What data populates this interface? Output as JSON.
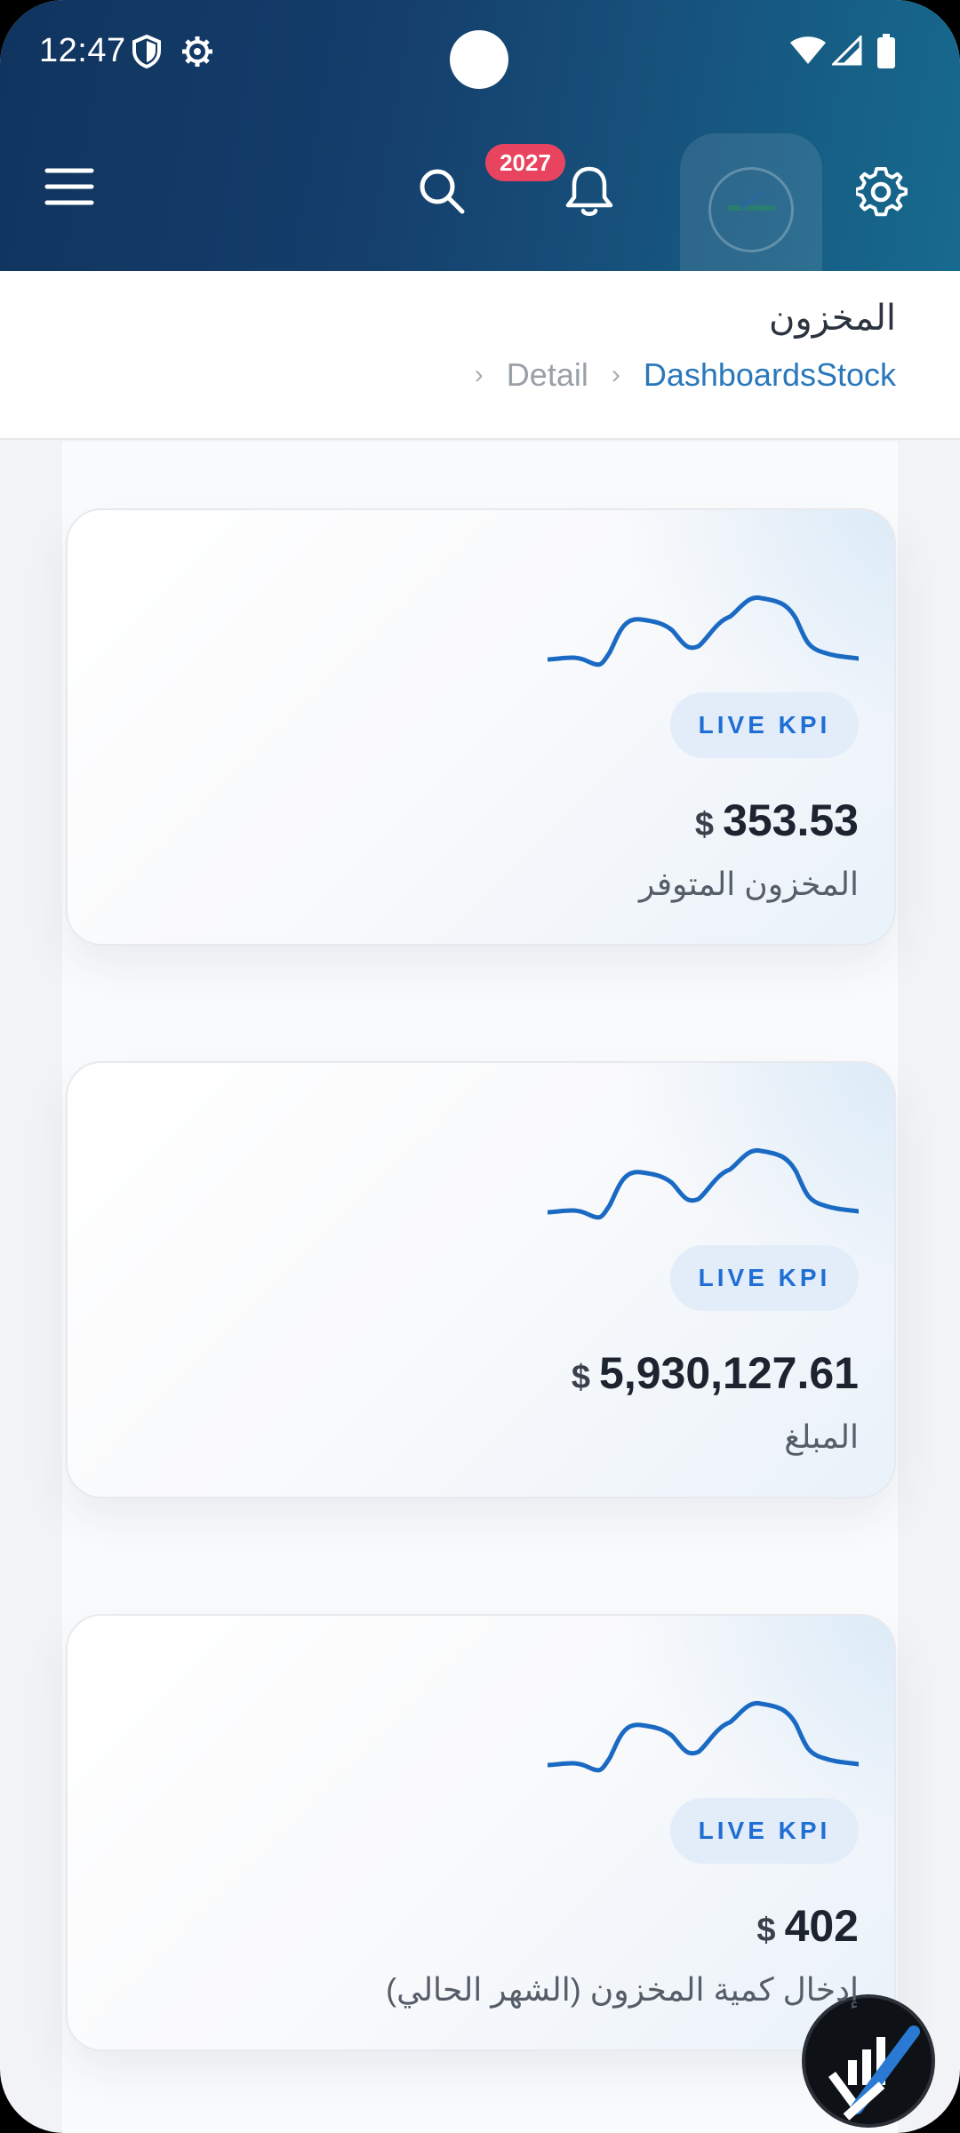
{
  "status": {
    "time": "12:47"
  },
  "header": {
    "notification_count": "2027"
  },
  "page": {
    "title": "المخزون",
    "breadcrumb": [
      "DashboardsStock",
      "Detail"
    ]
  },
  "cards": [
    {
      "badge": "LIVE KPI",
      "currency": "$",
      "value": "353.53",
      "label": "المخزون المتوفر"
    },
    {
      "badge": "LIVE KPI",
      "currency": "$",
      "value": "5,930,127.61",
      "label": "المبلغ"
    },
    {
      "badge": "LIVE KPI",
      "currency": "$",
      "value": "402",
      "label": "إدخال كمية المخزون (الشهر الحالي)"
    }
  ],
  "colors": {
    "accent": "#1f6ed4",
    "sparkline": "#1a6ac4",
    "badge_bg": "#e9445f",
    "header_start": "#10345f",
    "header_end": "#176a8e"
  },
  "icons": [
    "menu-icon",
    "search-icon",
    "bell-icon",
    "gear-icon",
    "shield-icon",
    "wifi-icon",
    "signal-icon",
    "battery-icon",
    "chevron-right-icon"
  ]
}
